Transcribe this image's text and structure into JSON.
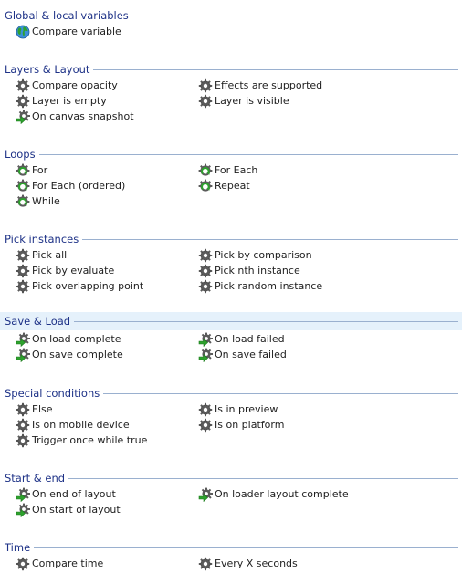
{
  "sections": [
    {
      "id": "global",
      "title": "Global & local variables",
      "items": [
        {
          "label": "Compare variable",
          "icon": "globe-icon"
        }
      ]
    },
    {
      "id": "layers",
      "title": "Layers & Layout",
      "items": [
        {
          "label": "Compare opacity",
          "icon": "gear-icon"
        },
        {
          "label": "Effects are supported",
          "icon": "gear-icon"
        },
        {
          "label": "Layer is empty",
          "icon": "gear-icon"
        },
        {
          "label": "Layer is visible",
          "icon": "gear-icon"
        },
        {
          "label": "On canvas snapshot",
          "icon": "trigger-arrow-icon"
        }
      ]
    },
    {
      "id": "loops",
      "title": "Loops",
      "items": [
        {
          "label": "For",
          "icon": "loop-icon"
        },
        {
          "label": "For Each",
          "icon": "loop-icon"
        },
        {
          "label": "For Each (ordered)",
          "icon": "loop-icon"
        },
        {
          "label": "Repeat",
          "icon": "loop-icon"
        },
        {
          "label": "While",
          "icon": "loop-icon"
        }
      ]
    },
    {
      "id": "pick",
      "title": "Pick instances",
      "items": [
        {
          "label": "Pick all",
          "icon": "gear-icon"
        },
        {
          "label": "Pick by comparison",
          "icon": "gear-icon"
        },
        {
          "label": "Pick by evaluate",
          "icon": "gear-icon"
        },
        {
          "label": "Pick nth instance",
          "icon": "gear-icon"
        },
        {
          "label": "Pick overlapping point",
          "icon": "gear-icon"
        },
        {
          "label": "Pick random instance",
          "icon": "gear-icon"
        }
      ]
    },
    {
      "id": "saveload",
      "title": "Save & Load",
      "highlight": true,
      "items": [
        {
          "label": "On load complete",
          "icon": "trigger-arrow-icon"
        },
        {
          "label": "On load failed",
          "icon": "trigger-arrow-icon"
        },
        {
          "label": "On save complete",
          "icon": "trigger-arrow-icon"
        },
        {
          "label": "On save failed",
          "icon": "trigger-arrow-icon"
        }
      ]
    },
    {
      "id": "special",
      "title": "Special conditions",
      "items": [
        {
          "label": "Else",
          "icon": "gear-icon"
        },
        {
          "label": "Is in preview",
          "icon": "gear-icon"
        },
        {
          "label": "Is on mobile device",
          "icon": "gear-icon"
        },
        {
          "label": "Is on platform",
          "icon": "gear-icon"
        },
        {
          "label": "Trigger once while true",
          "icon": "gear-icon"
        }
      ]
    },
    {
      "id": "startend",
      "title": "Start & end",
      "items": [
        {
          "label": "On end of layout",
          "icon": "trigger-arrow-icon"
        },
        {
          "label": "On loader layout complete",
          "icon": "trigger-arrow-icon"
        },
        {
          "label": "On start of layout",
          "icon": "trigger-arrow-icon"
        }
      ]
    },
    {
      "id": "time",
      "title": "Time",
      "items": [
        {
          "label": "Compare time",
          "icon": "gear-icon"
        },
        {
          "label": "Every X seconds",
          "icon": "gear-icon"
        }
      ]
    }
  ],
  "colors": {
    "header_text": "#1e3287",
    "rule": "#9ab0cf",
    "highlight_bg": "#e5f1fb",
    "gear": "#5b5b5b",
    "green": "#2ea22e"
  }
}
